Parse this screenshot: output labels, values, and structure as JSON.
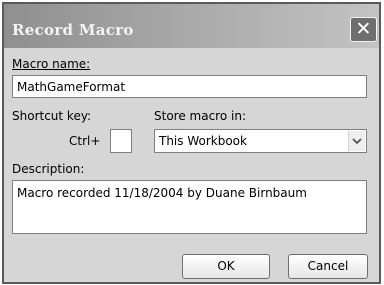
{
  "window": {
    "title": "Record Macro",
    "close_symbol": "✕"
  },
  "macro_name": {
    "label": "Macro name:",
    "value": "MathGameFormat"
  },
  "shortcut": {
    "label": "Shortcut key:",
    "prefix": "Ctrl+",
    "value": ""
  },
  "store": {
    "label": "Store macro in:",
    "selected": "This Workbook",
    "arrow_icon": "chevron-down-icon"
  },
  "description": {
    "label": "Description:",
    "value": "Macro recorded 11/18/2004 by Duane Birnbaum"
  },
  "buttons": {
    "ok": "OK",
    "cancel": "Cancel"
  }
}
